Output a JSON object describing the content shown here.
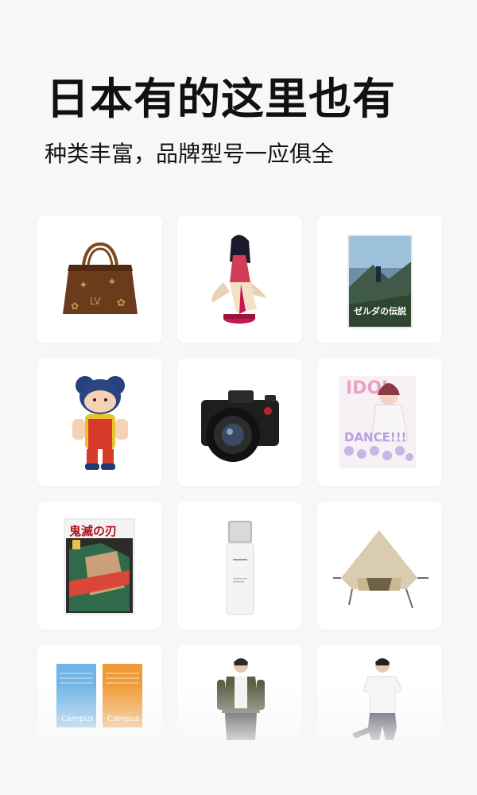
{
  "hero": {
    "title": "日本有的这里也有",
    "subtitle": "种类丰富，品牌型号一应俱全"
  },
  "products": [
    {
      "icon": "handbag-icon"
    },
    {
      "icon": "anime-figure-icon"
    },
    {
      "icon": "game-cover-icon",
      "cover_text": "ゼルダの伝説"
    },
    {
      "icon": "bear-figure-icon"
    },
    {
      "icon": "camera-icon"
    },
    {
      "icon": "magazine-icon",
      "cover_text": "IDOL",
      "cover_sub": "DANCE!!!"
    },
    {
      "icon": "manga-cover-icon",
      "cover_text": "鬼滅の刃"
    },
    {
      "icon": "skincare-bottle-icon"
    },
    {
      "icon": "tent-icon"
    },
    {
      "icon": "notebooks-icon",
      "cover_text": "Campus"
    },
    {
      "icon": "fashion-model-jacket-icon"
    },
    {
      "icon": "fashion-model-tshirt-icon"
    }
  ]
}
